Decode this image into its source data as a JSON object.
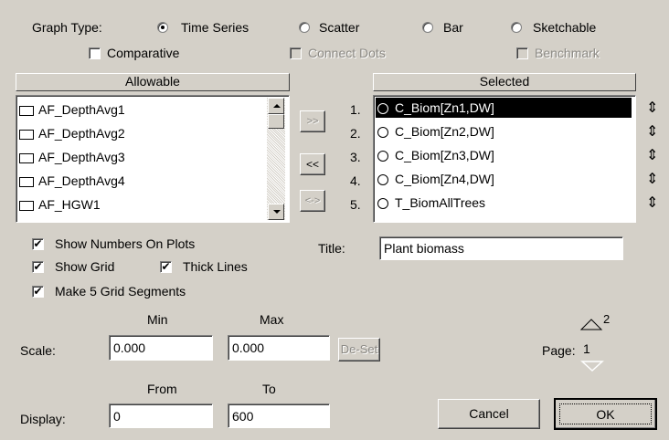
{
  "graph_type": {
    "label": "Graph Type:",
    "options": [
      "Time Series",
      "Scatter",
      "Bar",
      "Sketchable"
    ],
    "selected": "Time Series"
  },
  "options_row": {
    "comparative": "Comparative",
    "connect_dots": "Connect Dots",
    "benchmark": "Benchmark"
  },
  "allowable": {
    "header": "Allowable",
    "items": [
      "AF_DepthAvg1",
      "AF_DepthAvg2",
      "AF_DepthAvg3",
      "AF_DepthAvg4",
      "AF_HGW1"
    ]
  },
  "move_buttons": {
    "add": ">>",
    "remove": "<<",
    "swap": "<->"
  },
  "selected": {
    "header": "Selected",
    "numbers": [
      "1.",
      "2.",
      "3.",
      "4.",
      "5."
    ],
    "items": [
      "C_Biom[Zn1,DW]",
      "C_Biom[Zn2,DW]",
      "C_Biom[Zn3,DW]",
      "C_Biom[Zn4,DW]",
      "T_BiomAllTrees"
    ],
    "reorder_icon": "up-down-arrow-icon"
  },
  "checks": {
    "show_numbers": "Show Numbers On Plots",
    "show_grid": "Show Grid",
    "thick_lines": "Thick Lines",
    "grid_segments": "Make 5 Grid Segments",
    "check_mark": "✔"
  },
  "title": {
    "label": "Title:",
    "value": "Plant biomass"
  },
  "scale": {
    "label": "Scale:",
    "min_label": "Min",
    "max_label": "Max",
    "min_value": "0.000",
    "max_value": "0.000",
    "deset": "De-Set"
  },
  "display": {
    "label": "Display:",
    "from_label": "From",
    "to_label": "To",
    "from_value": "0",
    "to_value": "600"
  },
  "page": {
    "label": "Page:",
    "current": "1",
    "next": "2"
  },
  "buttons": {
    "cancel": "Cancel",
    "ok": "OK"
  }
}
